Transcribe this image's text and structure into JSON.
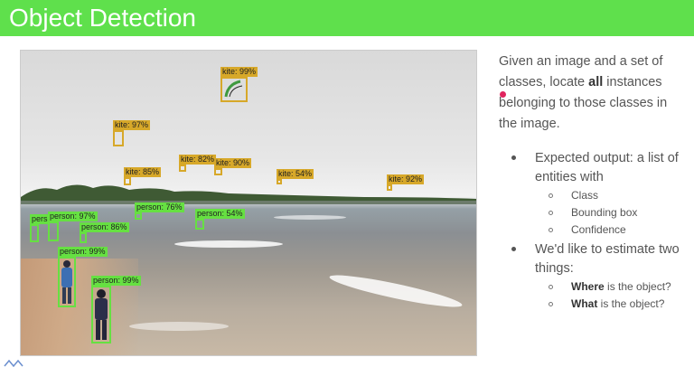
{
  "header": {
    "title": "Object Detection"
  },
  "description": {
    "part1": "Given an image and a set of classes, locate ",
    "bold": "all",
    "part2": " instances belonging to those classes in the image."
  },
  "bullets": {
    "expected": "Expected output: a list of entities with",
    "sub1": [
      "Class",
      "Bounding box",
      "Confidence"
    ],
    "estimate": "We'd like to estimate two things:",
    "where_bold": "Where",
    "where_rest": " is the object?",
    "what_bold": "What",
    "what_rest": " is the object?"
  },
  "detections": {
    "kite1": "kite: 99%",
    "kite2": "kite: 97%",
    "kite3": "kite: 82%",
    "kite4": "kite: 90%",
    "kite5": "kite: 85%",
    "kite6": "kite: 54%",
    "kite7": "kite: 92%",
    "person1": "pers",
    "person2": "person: 97%",
    "person3": "person: 86%",
    "person4": "person: 76%",
    "person5": "person: 54%",
    "person6": "person: 99%",
    "person7": "person: 99%"
  },
  "colors": {
    "title_bar": "#5fe04c",
    "kite_box": "#d7a829",
    "person_box": "#66e042"
  }
}
